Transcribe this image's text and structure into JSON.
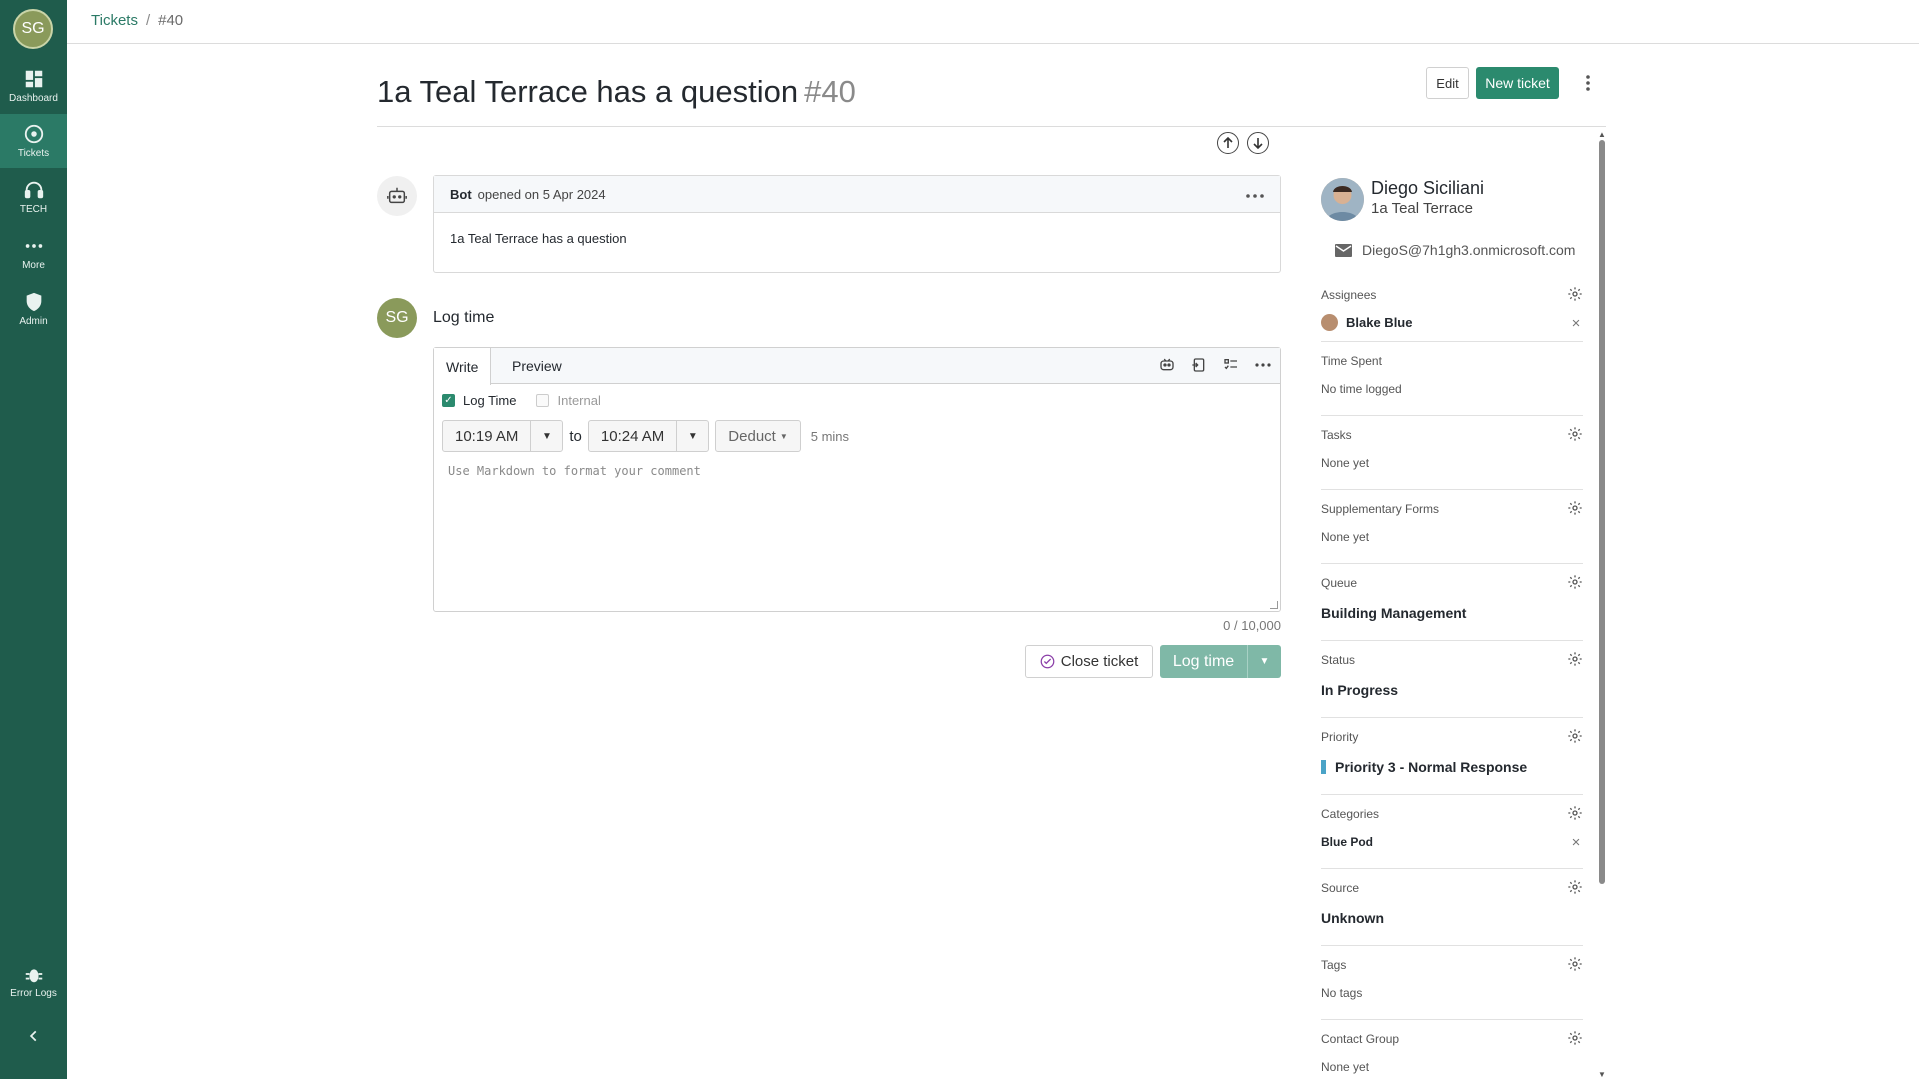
{
  "sidebar": {
    "user_initials": "SG",
    "items": [
      {
        "label": "Dashboard",
        "icon": "grid-icon"
      },
      {
        "label": "Tickets",
        "icon": "ticket-circle-icon"
      },
      {
        "label": "TECH",
        "icon": "headset-icon"
      },
      {
        "label": "More",
        "icon": "more-dots-icon"
      },
      {
        "label": "Admin",
        "icon": "admin-shield-icon"
      }
    ],
    "bottom": {
      "label": "Error Logs",
      "icon": "bug-icon"
    },
    "active_index": 1
  },
  "breadcrumb": {
    "parent": "Tickets",
    "separator": "/",
    "current": "#40"
  },
  "ticket": {
    "title": "1a Teal Terrace has a question",
    "number": "#40",
    "edit_label": "Edit",
    "new_ticket_label": "New ticket"
  },
  "bot_comment": {
    "author": "Bot",
    "meta": "opened on 5 Apr 2024",
    "body": "1a Teal Terrace has a question"
  },
  "log_time": {
    "avatar_initials": "SG",
    "heading": "Log time",
    "tabs": [
      "Write",
      "Preview"
    ],
    "log_time_checkbox": "Log Time",
    "internal_checkbox": "Internal",
    "start_time": "10:19 AM",
    "to_label": "to",
    "end_time": "10:24 AM",
    "deduct_label": "Deduct",
    "duration": "5 mins",
    "placeholder": "Use Markdown to format your comment",
    "char_count": "0 / 10,000",
    "close_label": "Close ticket",
    "submit_label": "Log time"
  },
  "contact": {
    "name": "Diego Siciliani",
    "org": "1a Teal Terrace",
    "email": "DiegoS@7h1gh3.onmicrosoft.com"
  },
  "panel": {
    "assignees": {
      "label": "Assignees",
      "value": "Blake Blue"
    },
    "time_spent": {
      "label": "Time Spent",
      "value": "No time logged"
    },
    "tasks": {
      "label": "Tasks",
      "value": "None yet"
    },
    "supplementary": {
      "label": "Supplementary Forms",
      "value": "None yet"
    },
    "queue": {
      "label": "Queue",
      "value": "Building Management"
    },
    "status": {
      "label": "Status",
      "value": "In Progress"
    },
    "priority": {
      "label": "Priority",
      "value": "Priority 3 - Normal Response",
      "color": "#4aa3c7"
    },
    "categories": {
      "label": "Categories",
      "value": "Blue Pod"
    },
    "source": {
      "label": "Source",
      "value": "Unknown"
    },
    "tags": {
      "label": "Tags",
      "value": "No tags"
    },
    "contact_group": {
      "label": "Contact Group",
      "value": "None yet"
    }
  },
  "colors": {
    "sidebar": "#1f5c4c",
    "accent": "#2b8a6e",
    "link": "#2b7a66"
  }
}
